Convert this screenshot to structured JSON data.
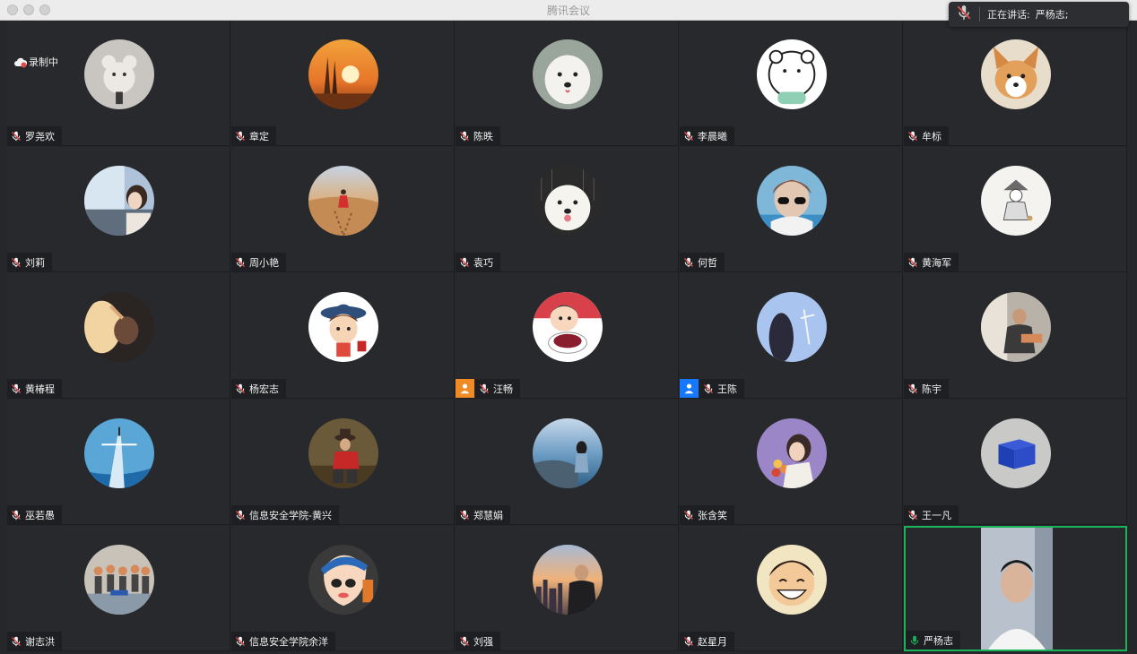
{
  "window": {
    "title": "腾讯会议"
  },
  "recording": {
    "label": "录制中"
  },
  "speaking": {
    "label": "正在讲话:",
    "names": "严杨志;"
  },
  "colors": {
    "self_border": "#19b35a",
    "mic_muted": "#e64b4b",
    "mic_active": "#19b35a",
    "orange_user": "#f08a24",
    "blue_user": "#1677ff"
  },
  "participants": [
    {
      "name": "罗尧欢",
      "mic": "muted",
      "avatar": "plush-toy"
    },
    {
      "name": "章定",
      "mic": "muted",
      "avatar": "sunset-towers"
    },
    {
      "name": "陈昳",
      "mic": "muted",
      "avatar": "white-dog"
    },
    {
      "name": "李晨曦",
      "mic": "muted",
      "avatar": "cartoon-bear"
    },
    {
      "name": "牟标",
      "mic": "muted",
      "avatar": "corgi"
    },
    {
      "name": "刘莉",
      "mic": "muted",
      "avatar": "girl-window"
    },
    {
      "name": "周小艳",
      "mic": "muted",
      "avatar": "desert-girl"
    },
    {
      "name": "袁巧",
      "mic": "muted",
      "avatar": "samoyed"
    },
    {
      "name": "何哲",
      "mic": "muted",
      "avatar": "sunglasses-person"
    },
    {
      "name": "黄海军",
      "mic": "muted",
      "avatar": "sketch-figure"
    },
    {
      "name": "黄椿程",
      "mic": "muted",
      "avatar": "girl-lamp"
    },
    {
      "name": "杨宏志",
      "mic": "muted",
      "avatar": "cartoon-boy-hat"
    },
    {
      "name": "汪畅",
      "mic": "muted",
      "avatar": "crayon-shin",
      "badge": "orange"
    },
    {
      "name": "王陈",
      "mic": "muted",
      "avatar": "blue-sky-girl",
      "badge": "blue"
    },
    {
      "name": "陈宇",
      "mic": "muted",
      "avatar": "man-room"
    },
    {
      "name": "巫若愚",
      "mic": "muted",
      "avatar": "blue-tower"
    },
    {
      "name": "信息安全学院-黄兴",
      "mic": "muted",
      "avatar": "cowboy-sitting"
    },
    {
      "name": "郑慧娟",
      "mic": "muted",
      "avatar": "seaside-girl"
    },
    {
      "name": "张含笑",
      "mic": "muted",
      "avatar": "flower-girl"
    },
    {
      "name": "王一凡",
      "mic": "muted",
      "avatar": "blue-box"
    },
    {
      "name": "谢志洪",
      "mic": "muted",
      "avatar": "group-photo"
    },
    {
      "name": "信息安全学院余洋",
      "mic": "muted",
      "avatar": "crayon-shin-2"
    },
    {
      "name": "刘强",
      "mic": "muted",
      "avatar": "city-sunset-man"
    },
    {
      "name": "赵星月",
      "mic": "muted",
      "avatar": "luffy-smile"
    },
    {
      "name": "严杨志",
      "mic": "active",
      "avatar": "live-video",
      "self": true
    }
  ]
}
